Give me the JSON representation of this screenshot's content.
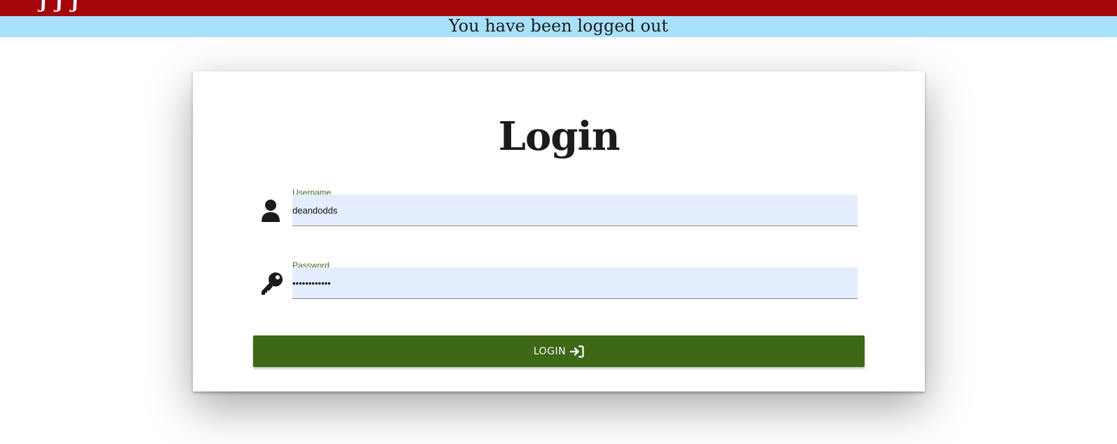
{
  "header": {
    "logo_text": "ʃʃʃ"
  },
  "notice": {
    "message": "You have been logged out"
  },
  "login_form": {
    "title": "Login",
    "username": {
      "label": "Username",
      "value": "deandodds",
      "icon": "user-icon"
    },
    "password": {
      "label": "Password",
      "value": "••••••••••••",
      "icon": "key-icon"
    },
    "submit": {
      "label": "LOGIN",
      "icon": "sign-in-icon"
    }
  },
  "colors": {
    "top_bar": "#a3050b",
    "notice_bar": "#a8e1fb",
    "button": "#3d6816",
    "field_label": "#3a6a16",
    "input_background": "#e3edfd"
  }
}
